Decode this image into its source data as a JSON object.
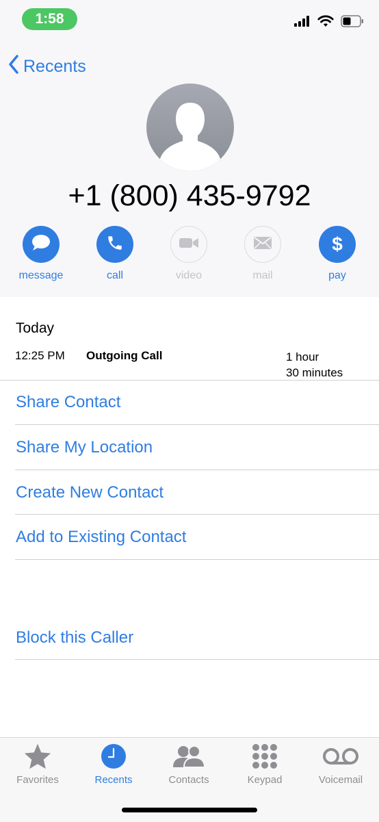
{
  "status_bar": {
    "time": "1:58"
  },
  "nav": {
    "back_label": "Recents"
  },
  "contact": {
    "phone_number": "+1 (800) 435-9792"
  },
  "actions": [
    {
      "label": "message",
      "icon": "message-icon",
      "enabled": true
    },
    {
      "label": "call",
      "icon": "phone-icon",
      "enabled": true
    },
    {
      "label": "video",
      "icon": "video-icon",
      "enabled": false
    },
    {
      "label": "mail",
      "icon": "mail-icon",
      "enabled": false
    },
    {
      "label": "pay",
      "icon": "dollar-icon",
      "enabled": true
    }
  ],
  "call_log": {
    "heading": "Today",
    "entries": [
      {
        "time": "12:25 PM",
        "type": "Outgoing Call",
        "duration_line1": "1 hour",
        "duration_line2": "30 minutes"
      }
    ]
  },
  "options": [
    "Share Contact",
    "Share My Location",
    "Create New Contact",
    "Add to Existing Contact"
  ],
  "block": "Block this Caller",
  "tabs": [
    {
      "label": "Favorites",
      "icon": "star-icon",
      "active": false
    },
    {
      "label": "Recents",
      "icon": "clock-icon",
      "active": true
    },
    {
      "label": "Contacts",
      "icon": "contacts-icon",
      "active": false
    },
    {
      "label": "Keypad",
      "icon": "keypad-icon",
      "active": false
    },
    {
      "label": "Voicemail",
      "icon": "voicemail-icon",
      "active": false
    }
  ],
  "colors": {
    "accent": "#2f7de1",
    "status_pill": "#4cc763",
    "inactive_gray": "#8e8e93"
  }
}
